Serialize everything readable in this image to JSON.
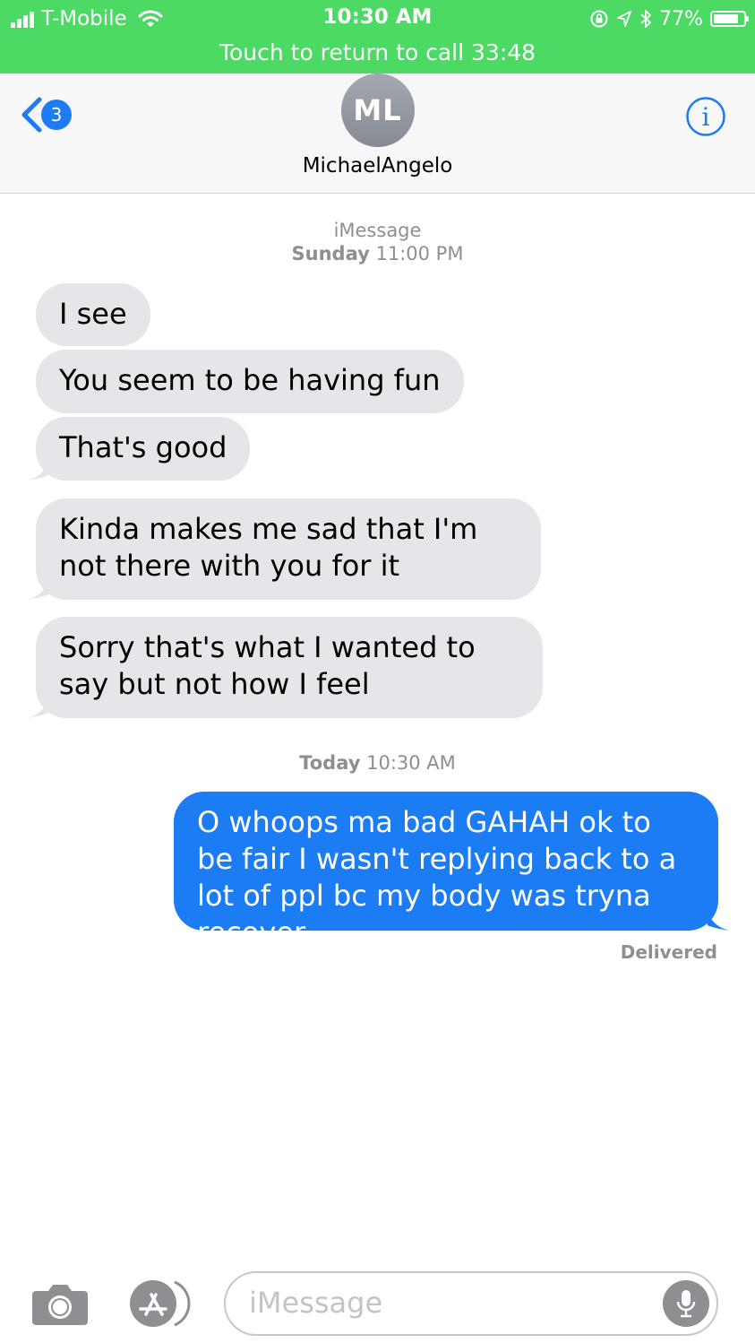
{
  "status_bar": {
    "carrier": "T-Mobile",
    "time": "10:30 AM",
    "battery": "77%",
    "call_banner": "Touch to return to call 33:48",
    "background_color": "#4cd964"
  },
  "nav": {
    "back_badge": "3",
    "avatar_initials": "ML",
    "contact_name": "MichaelAngelo",
    "info_glyph": "i"
  },
  "conversation": {
    "header_service": "iMessage",
    "header_day": "Sunday",
    "header_time": "11:00 PM",
    "incoming": [
      "I see",
      "You seem to be having fun",
      "That's good",
      "Kinda makes me sad that I'm not there with you for it",
      "Sorry that's what I wanted to say but not how I feel"
    ],
    "today_day": "Today",
    "today_time": "10:30 AM",
    "outgoing": [
      "O whoops ma bad GAHAH ok to be fair I wasn't replying back to a lot of ppl bc my body was tryna recover"
    ],
    "delivered_label": "Delivered"
  },
  "input_bar": {
    "placeholder": "iMessage",
    "icons": [
      "camera-icon",
      "app-store-icon",
      "microphone-icon"
    ]
  },
  "colors": {
    "incoming_bubble": "#e5e5ea",
    "outgoing_bubble": "#1b7cf4",
    "accent": "#1d7cf2"
  }
}
